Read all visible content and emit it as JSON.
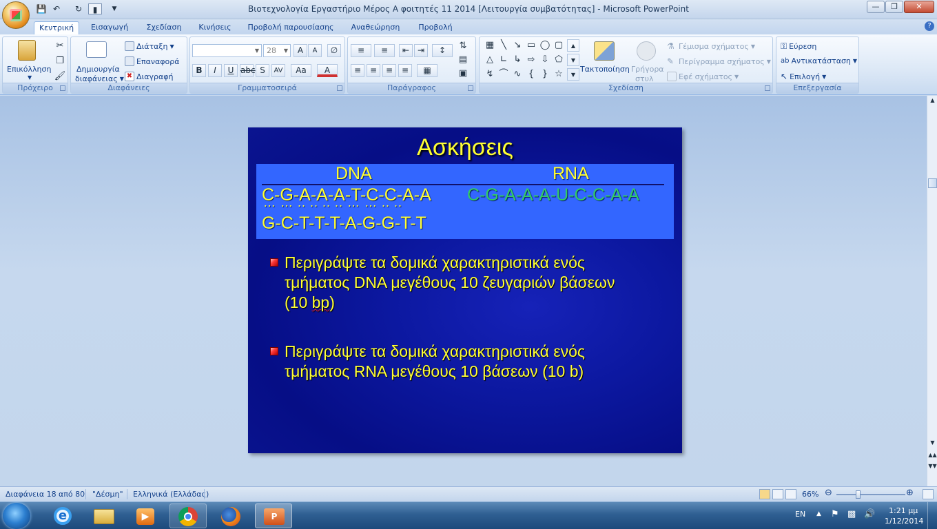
{
  "window": {
    "title": "Βιοτεχνολογία Εργαστήριο Μέρος Α φοιτητές 11 2014 [Λειτουργία συμβατότητας] - Microsoft PowerPoint"
  },
  "tabs": [
    "Κεντρική",
    "Εισαγωγή",
    "Σχεδίαση",
    "Κινήσεις",
    "Προβολή παρουσίασης",
    "Αναθεώρηση",
    "Προβολή"
  ],
  "ribbon": {
    "clipboard": {
      "paste": "Επικόλληση",
      "label": "Πρόχειρο"
    },
    "slides": {
      "new_slide_1": "Δημιουργία",
      "new_slide_2": "διαφάνειας",
      "layout": "Διάταξη",
      "reset": "Επαναφορά",
      "delete": "Διαγραφή",
      "label": "Διαφάνειες"
    },
    "font": {
      "size": "28",
      "label": "Γραμματοσειρά"
    },
    "paragraph": {
      "label": "Παράγραφος"
    },
    "drawing": {
      "arrange": "Τακτοποίηση",
      "quick_styles_1": "Γρήγορα",
      "quick_styles_2": "στυλ",
      "fill": "Γέμισμα σχήματος",
      "outline": "Περίγραμμα σχήματος",
      "effects": "Εφέ σχήματος",
      "label": "Σχεδίαση"
    },
    "editing": {
      "find": "Εύρεση",
      "replace": "Αντικατάσταση",
      "select": "Επιλογή",
      "label": "Επεξεργασία"
    }
  },
  "slide": {
    "title": "Ασκήσεις",
    "dna_header": "DNA",
    "rna_header": "RNA",
    "dna_strand_top": "C-G-A-A-A-T-C-C-A-A",
    "dna_dots": "…  …  ..  ..  ..  ..  …  …  ..  ..",
    "dna_strand_bottom": "G-C-T-T-T-A-G-G-T-T",
    "rna_strand": "C-G-A-A-A-U-C-C-A-A",
    "bullets": [
      {
        "line1": "Περιγράψτε τα δομικά χαρακτηριστικά ενός",
        "line2": "τμήματος DNA μεγέθους 10 ζευγαριών βάσεων",
        "line3_pre": "(10 ",
        "line3_squig": "bp",
        "line3_post": ")"
      },
      {
        "line1": "Περιγράψτε τα δομικά χαρακτηριστικά ενός",
        "line2": "τμήματος RNA μεγέθους 10 βάσεων (10 b)"
      }
    ],
    "colors": {
      "title": "#ffff33",
      "rna_strand": "#33cc66",
      "table_bg": "#3366ff"
    }
  },
  "status": {
    "slide_info": "Διαφάνεια 18 από 80",
    "theme": "\"Δέσμη\"",
    "language": "Ελληνικά (Ελλάδας)",
    "zoom": "66%",
    "zoom_level": 0.66
  },
  "taskbar": {
    "lang": "EN",
    "time": "1:21 μμ",
    "date": "1/12/2014"
  }
}
